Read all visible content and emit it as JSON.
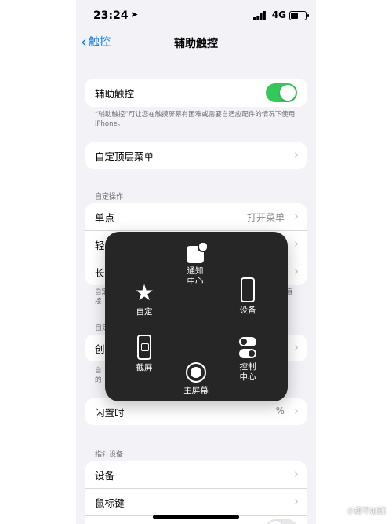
{
  "status": {
    "time": "23:24",
    "network": "4G"
  },
  "nav": {
    "back": "触控",
    "title": "辅助触控"
  },
  "assistive": {
    "label": "辅助触控",
    "note": "“辅助触控”可让您在触摸屏幕有困难或需要自适应配件的情况下使用iPhone。"
  },
  "custom_menu": {
    "label": "自定顶层菜单"
  },
  "custom_actions": {
    "header": "自定操作",
    "rows": [
      {
        "label": "单点",
        "value": "打开菜单"
      },
      {
        "label": "轻"
      },
      {
        "label": "长"
      }
    ],
    "note_left": "自定\n接",
    "note_right": "直"
  },
  "custom_gestures": {
    "header": "自定",
    "row": "创",
    "note": "自\n的"
  },
  "idle": {
    "label": "闲置时",
    "value": "%"
  },
  "pointer": {
    "header": "指针设备",
    "rows": [
      {
        "label": "设备"
      },
      {
        "label": "鼠标键"
      }
    ]
  },
  "menu": {
    "notification": "通知\n中心",
    "custom": "自定",
    "device": "设备",
    "screenshot": "截屏",
    "home": "主屏幕",
    "control": "控制\n中心"
  },
  "watermark": "小椰不加班"
}
